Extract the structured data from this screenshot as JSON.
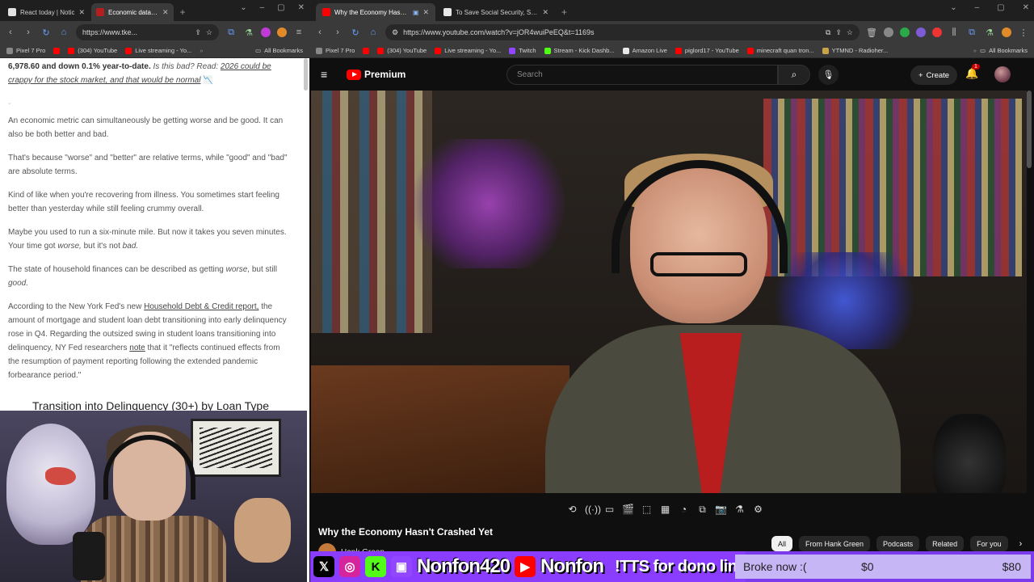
{
  "left_window": {
    "tabs": [
      {
        "title": "React today | Notic",
        "active": false,
        "favicon_color": "#e2e2e2"
      },
      {
        "title": "Economic data can",
        "active": true,
        "favicon_color": "#b51e1e"
      }
    ],
    "url": "https://www.tke...",
    "bookmarks": [
      {
        "label": "Pixel 7 Pro",
        "color": "#888888"
      },
      {
        "label": "",
        "color": "#ff0000"
      },
      {
        "label": "(304) YouTube",
        "color": "#ff0000"
      },
      {
        "label": "Live streaming - Yo...",
        "color": "#ff0000"
      }
    ],
    "all_bookmarks": "All Bookmarks",
    "article": {
      "lead_bold": "6,978.60 and down 0.1% year-to-date.",
      "lead_italic": "Is this bad? Read:",
      "lead_link": "2026 could be crappy for the stock market, and that would be normal",
      "dash": "-",
      "p1": "An economic metric can simultaneously be getting worse and be good. It can also be both better and bad.",
      "p2": "That's because \"worse\" and \"better\" are relative terms, while \"good\" and \"bad\" are absolute terms.",
      "p3": "Kind of like when you're recovering from illness. You sometimes start feeling better than yesterday while still feeling crummy overall.",
      "p4_a": "Maybe you used to run a six-minute mile. But now it takes you seven minutes. Your time got",
      "p4_worse": "worse,",
      "p4_b": "but it's not",
      "p4_bad": "bad.",
      "p5_a": "The state of household finances can be described as getting",
      "p5_worse": "worse,",
      "p5_b": "but still",
      "p5_good": "good.",
      "p6_a": "According to the New York Fed's new",
      "p6_link": "Household Debt & Credit report,",
      "p6_b": "the amount of mortgage and student loan debt transitioning into early delinquency rose in Q4. Regarding the outsized swing in student loans transitioning into delinquency, NY Fed researchers",
      "p6_note": "note",
      "p6_c": "that it \"reflects continued effects from the resumption of payment reporting following the extended pandemic forbearance period.\""
    },
    "chart_title": "Transition into Delinquency (30+) by Loan Type"
  },
  "right_window": {
    "tabs": [
      {
        "title": "Why the Economy Hasn't C",
        "active": true,
        "favicon_color": "#ff0000"
      },
      {
        "title": "To Save Social Security, Stop Sl",
        "active": false,
        "favicon_color": "#e8e8e8"
      }
    ],
    "url": "https://www.youtube.com/watch?v=jOR4wuiPeEQ&t=1169s",
    "bookmarks": [
      {
        "label": "Pixel 7 Pro",
        "color": "#888888"
      },
      {
        "label": "",
        "color": "#ff0000"
      },
      {
        "label": "(304) YouTube",
        "color": "#ff0000"
      },
      {
        "label": "Live streaming - Yo...",
        "color": "#ff0000"
      },
      {
        "label": "Twitch",
        "color": "#9146ff"
      },
      {
        "label": "Stream - Kick Dashb...",
        "color": "#53fc18"
      },
      {
        "label": "Amazon Live",
        "color": "#e8e8e8"
      },
      {
        "label": "piglord17 - YouTube",
        "color": "#ff0000"
      },
      {
        "label": "minecraft quan tron...",
        "color": "#ff0000"
      },
      {
        "label": "YTMND - Radioher...",
        "color": "#c9a24a"
      }
    ],
    "all_bookmarks": "All Bookmarks",
    "youtube": {
      "brand": "Premium",
      "search_placeholder": "Search",
      "create_label": "Create",
      "notif_count": "1",
      "video_title": "Why the Economy Hasn't Crashed Yet",
      "channel": "Hank Green",
      "chips": [
        {
          "label": "All",
          "active": true
        },
        {
          "label": "From Hank Green",
          "active": false
        },
        {
          "label": "Podcasts",
          "active": false
        },
        {
          "label": "Related",
          "active": false
        },
        {
          "label": "For you",
          "active": false
        }
      ]
    }
  },
  "stream_overlay": {
    "handle_1": "Nonfon420",
    "handle_2": "Nonfon",
    "tts": "!TTS for dono link",
    "goal_label": "Broke now :(",
    "goal_current": "$0",
    "goal_max": "$80",
    "accent": "#7c3aed"
  }
}
